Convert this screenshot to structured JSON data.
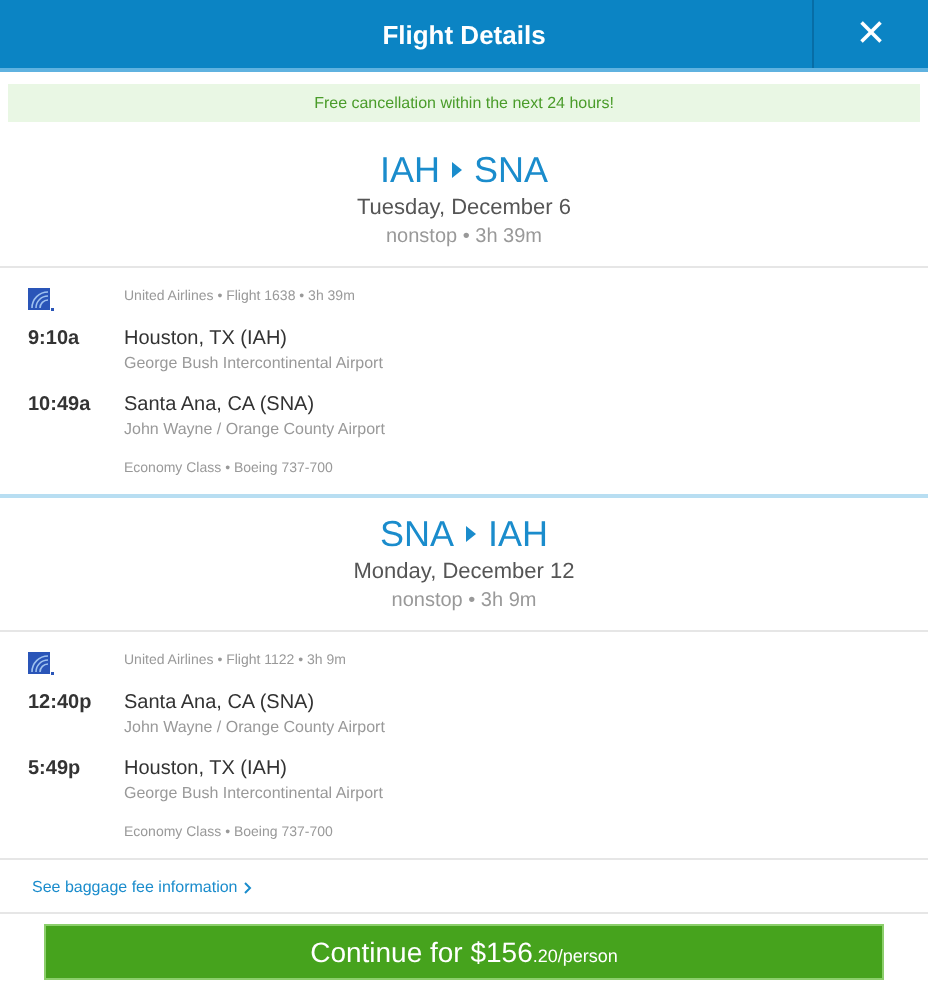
{
  "window": {
    "title": "Flight Details",
    "close": "×"
  },
  "banner": "Free cancellation within the next 24 hours!",
  "legs": [
    {
      "origin": "IAH",
      "destination": "SNA",
      "date": "Tuesday, December 6",
      "summary": "nonstop • 3h 39m",
      "flight_info": "United Airlines • Flight 1638 • 3h 39m",
      "stops": [
        {
          "time": "9:10a",
          "city": "Houston, TX (IAH)",
          "airport": "George Bush Intercontinental Airport"
        },
        {
          "time": "10:49a",
          "city": "Santa Ana, CA (SNA)",
          "airport": "John Wayne / Orange County Airport"
        }
      ],
      "cabin": "Economy Class • Boeing 737-700"
    },
    {
      "origin": "SNA",
      "destination": "IAH",
      "date": "Monday, December 12",
      "summary": "nonstop • 3h 9m",
      "flight_info": "United Airlines • Flight 1122 • 3h 9m",
      "stops": [
        {
          "time": "12:40p",
          "city": "Santa Ana, CA (SNA)",
          "airport": "John Wayne / Orange County Airport"
        },
        {
          "time": "5:49p",
          "city": "Houston, TX (IAH)",
          "airport": "George Bush Intercontinental Airport"
        }
      ],
      "cabin": "Economy Class • Boeing 737-700"
    }
  ],
  "baggage_link": "See baggage fee information",
  "continue_button": {
    "label": "Continue for $156",
    "suffix": ".20/person"
  }
}
